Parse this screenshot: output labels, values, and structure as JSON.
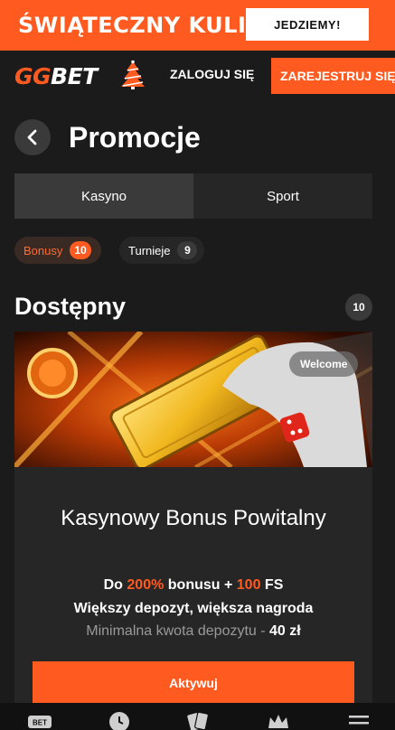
{
  "promo_banner": {
    "title": "ŚWIĄTECZNY KULIG",
    "button_label": "JEDZIEMY!"
  },
  "header": {
    "logo_gg": "GG",
    "logo_bet": "BET",
    "login_label": "ZALOGUJ SIĘ",
    "register_label": "ZAREJESTRUJ SIĘ"
  },
  "page": {
    "title": "Promocje"
  },
  "tabs": [
    {
      "label": "Kasyno",
      "active": true
    },
    {
      "label": "Sport",
      "active": false
    }
  ],
  "chips": [
    {
      "label": "Bonusy",
      "count": "10",
      "active": true
    },
    {
      "label": "Turnieje",
      "count": "9",
      "active": false
    }
  ],
  "section": {
    "title": "Dostępny",
    "count": "10"
  },
  "card": {
    "image_tag": "Welcome",
    "title": "Kasynowy Bonus Powitalny",
    "line1_prefix": "Do ",
    "line1_percent": "200%",
    "line1_middle": " bonusu + ",
    "line1_fs": "100",
    "line1_suffix": " FS",
    "line2": "Większy depozyt, większa nagroda",
    "line3_prefix": "Minimalna kwota depozytu - ",
    "line3_amount": "40 zł",
    "button_label": "Aktywuj"
  },
  "bottom_nav": {
    "bet_label": "BET"
  },
  "colors": {
    "accent": "#ff5a1f",
    "background": "#1b1b1b",
    "surface": "#262626"
  }
}
